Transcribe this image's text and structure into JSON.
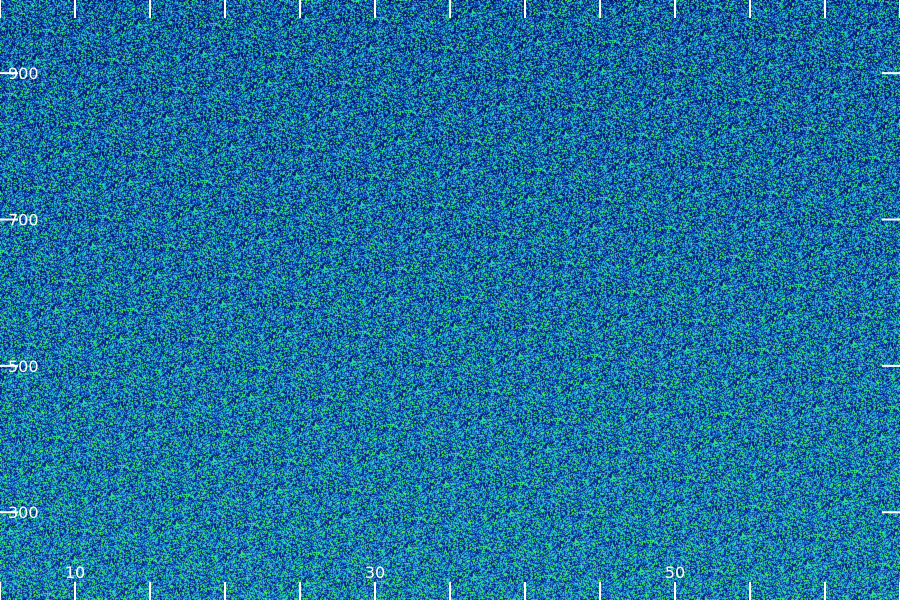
{
  "chart_data": {
    "type": "heatmap",
    "title": "",
    "xlabel": "",
    "ylabel": "",
    "xlim": [
      5,
      65
    ],
    "ylim": [
      180,
      1000
    ],
    "x_ticks": [
      5,
      10,
      15,
      20,
      25,
      30,
      35,
      40,
      45,
      50,
      55,
      60,
      65
    ],
    "x_tick_labels": [
      "10",
      "30",
      "50"
    ],
    "x_tick_label_values": [
      10,
      30,
      50
    ],
    "y_ticks": [
      300,
      500,
      700,
      900
    ],
    "y_tick_labels": [
      "300",
      "500",
      "700",
      "900"
    ],
    "y_tick_label_values": [
      300,
      500,
      700,
      900
    ],
    "colormap": [
      "#000033",
      "#0a1a8a",
      "#1450d2",
      "#1e9be6",
      "#1ee6c8",
      "#50ff3c"
    ],
    "grid": false,
    "legend": "none"
  }
}
